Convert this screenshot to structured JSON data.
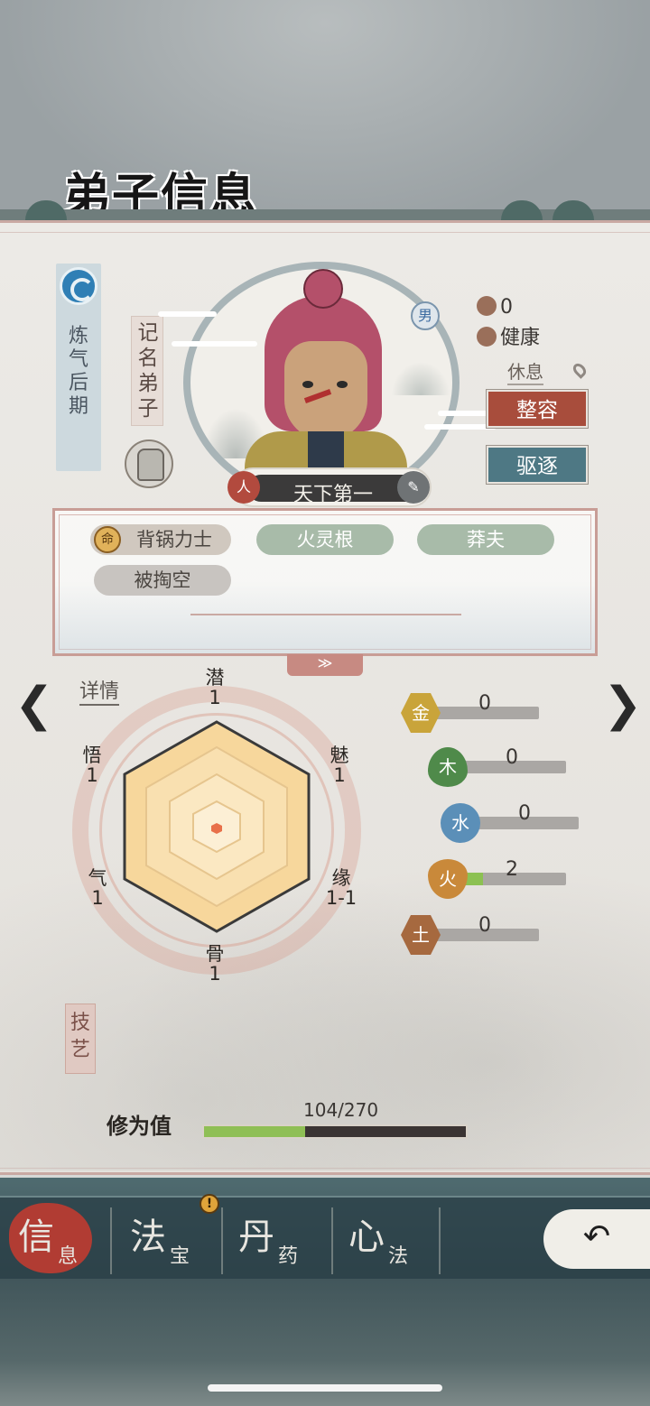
{
  "header": {
    "title": "弟子信息"
  },
  "disciple": {
    "realm": "炼气后期",
    "rank": "记名弟子",
    "gender": "男",
    "title_name": "天下第一",
    "title_left_icon": "人",
    "title_right_icon": "brush-icon"
  },
  "status": {
    "coins": "0",
    "health": "健康",
    "activity": "休息"
  },
  "buttons": {
    "makeover": "整容",
    "expel": "驱逐"
  },
  "traits": [
    {
      "label": "背锅力士",
      "icon": "命"
    },
    {
      "label": "火灵根"
    },
    {
      "label": "莽夫"
    },
    {
      "label": "被掏空"
    }
  ],
  "expand_icon": "≫",
  "details_link": "详情",
  "attributes": [
    {
      "name": "潜",
      "value": "1"
    },
    {
      "name": "魅",
      "value": "1"
    },
    {
      "name": "缘",
      "value": "1-1"
    },
    {
      "name": "骨",
      "value": "1"
    },
    {
      "name": "气",
      "value": "1"
    },
    {
      "name": "悟",
      "value": "1"
    }
  ],
  "elements": [
    {
      "name": "金",
      "value": "0",
      "fraction": 0,
      "color": "#c9a43a"
    },
    {
      "name": "木",
      "value": "0",
      "fraction": 0,
      "color": "#4f8a4a"
    },
    {
      "name": "水",
      "value": "0",
      "fraction": 0,
      "color": "#5b8fb8"
    },
    {
      "name": "火",
      "value": "2",
      "fraction": 0.2,
      "color": "#c9893a"
    },
    {
      "name": "土",
      "value": "0",
      "fraction": 0,
      "color": "#a6693f"
    }
  ],
  "skills_label": "技艺",
  "cultivation": {
    "label": "修为值",
    "text": "104/270",
    "current": 104,
    "max": 270
  },
  "tabs": [
    {
      "big": "信",
      "small": "息"
    },
    {
      "big": "法",
      "small": "宝"
    },
    {
      "big": "丹",
      "small": "药"
    },
    {
      "big": "心",
      "small": "法"
    }
  ],
  "alert_icon": "!",
  "back_icon": "↶",
  "nav": {
    "prev": "❮",
    "next": "❯"
  },
  "colors": {
    "accent_red": "#a84d3c",
    "accent_teal": "#4e7884",
    "progress_green": "#8fbf55"
  }
}
